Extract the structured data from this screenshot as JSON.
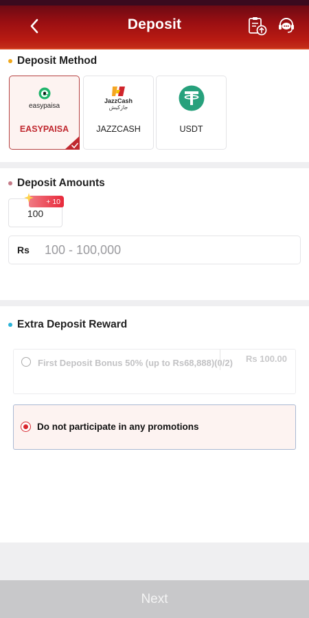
{
  "header": {
    "title": "Deposit",
    "back_icon": "chevron-left-icon",
    "history_icon": "clipboard-upload-icon",
    "support_icon": "headset-chat-icon"
  },
  "deposit_method": {
    "title": "Deposit Method",
    "dot_color": "#f0a81c",
    "methods": [
      {
        "label": "EASYPAISA",
        "logo_text": "easypaisa",
        "selected": true
      },
      {
        "label": "JAZZCASH",
        "logo_text": "JazzCash",
        "logo_text_urdu": "جازکیش",
        "selected": false
      },
      {
        "label": "USDT",
        "selected": false
      }
    ]
  },
  "deposit_amounts": {
    "title": "Deposit Amounts",
    "dot_color": "#c47b88",
    "preset": {
      "value": "100",
      "bonus": "+ 10"
    },
    "input": {
      "currency": "Rs",
      "placeholder": "100 - 100,000",
      "value": ""
    }
  },
  "extra_reward": {
    "title": "Extra Deposit Reward",
    "dot_color": "#2ab3d8",
    "options": [
      {
        "text": "First Deposit Bonus 50% (up to Rs68,888)(0/2)",
        "amount": "Rs 100.00",
        "selected": false,
        "disabled": true
      },
      {
        "text": "Do not participate in any promotions",
        "selected": true
      }
    ]
  },
  "footer": {
    "next_label": "Next"
  },
  "colors": {
    "brand_red": "#b81a12",
    "selected_red": "#c0282f",
    "usdt_green": "#27a17c"
  }
}
